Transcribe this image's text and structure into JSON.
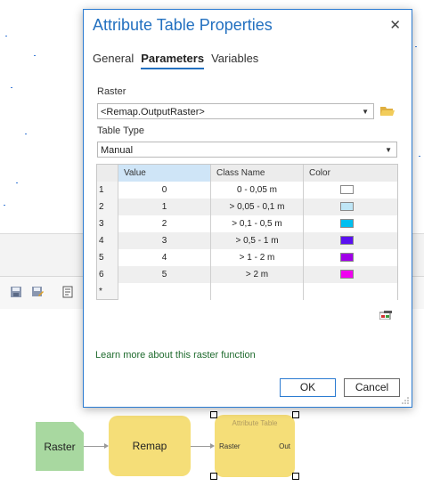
{
  "dialog": {
    "title": "Attribute Table Properties",
    "close_glyph": "✕",
    "tabs": [
      {
        "label": "General",
        "active": false
      },
      {
        "label": "Parameters",
        "active": true
      },
      {
        "label": "Variables",
        "active": false
      }
    ],
    "raster_label": "Raster",
    "raster_value": "<Remap.OutputRaster>",
    "table_type_label": "Table Type",
    "table_type_value": "Manual",
    "table": {
      "headers": [
        "Value",
        "Class Name",
        "Color"
      ],
      "rows": [
        {
          "n": "1",
          "value": "0",
          "class_name": "0 - 0,05 m",
          "color": "#ffffff"
        },
        {
          "n": "2",
          "value": "1",
          "class_name": "> 0,05 - 0,1 m",
          "color": "#bfe6f6"
        },
        {
          "n": "3",
          "value": "2",
          "class_name": "> 0,1 - 0,5 m",
          "color": "#00bfef"
        },
        {
          "n": "4",
          "value": "3",
          "class_name": "> 0,5 - 1 m",
          "color": "#5a10f0"
        },
        {
          "n": "5",
          "value": "4",
          "class_name": "> 1 - 2 m",
          "color": "#a000e8"
        },
        {
          "n": "6",
          "value": "5",
          "class_name": "> 2 m",
          "color": "#f000f0"
        }
      ],
      "new_row_marker": "*"
    },
    "learn_more": "Learn more about this raster function",
    "ok_label": "OK",
    "cancel_label": "Cancel"
  },
  "model": {
    "raster_node": "Raster",
    "remap_node": "Remap",
    "attr_node_title": "Attribute Table",
    "attr_in": "Raster",
    "attr_out": "Out"
  },
  "colors": {
    "accent": "#2270c0",
    "link": "#1f6b2e",
    "raster_node": "#a8d8a0",
    "function_node": "#f5de78"
  }
}
